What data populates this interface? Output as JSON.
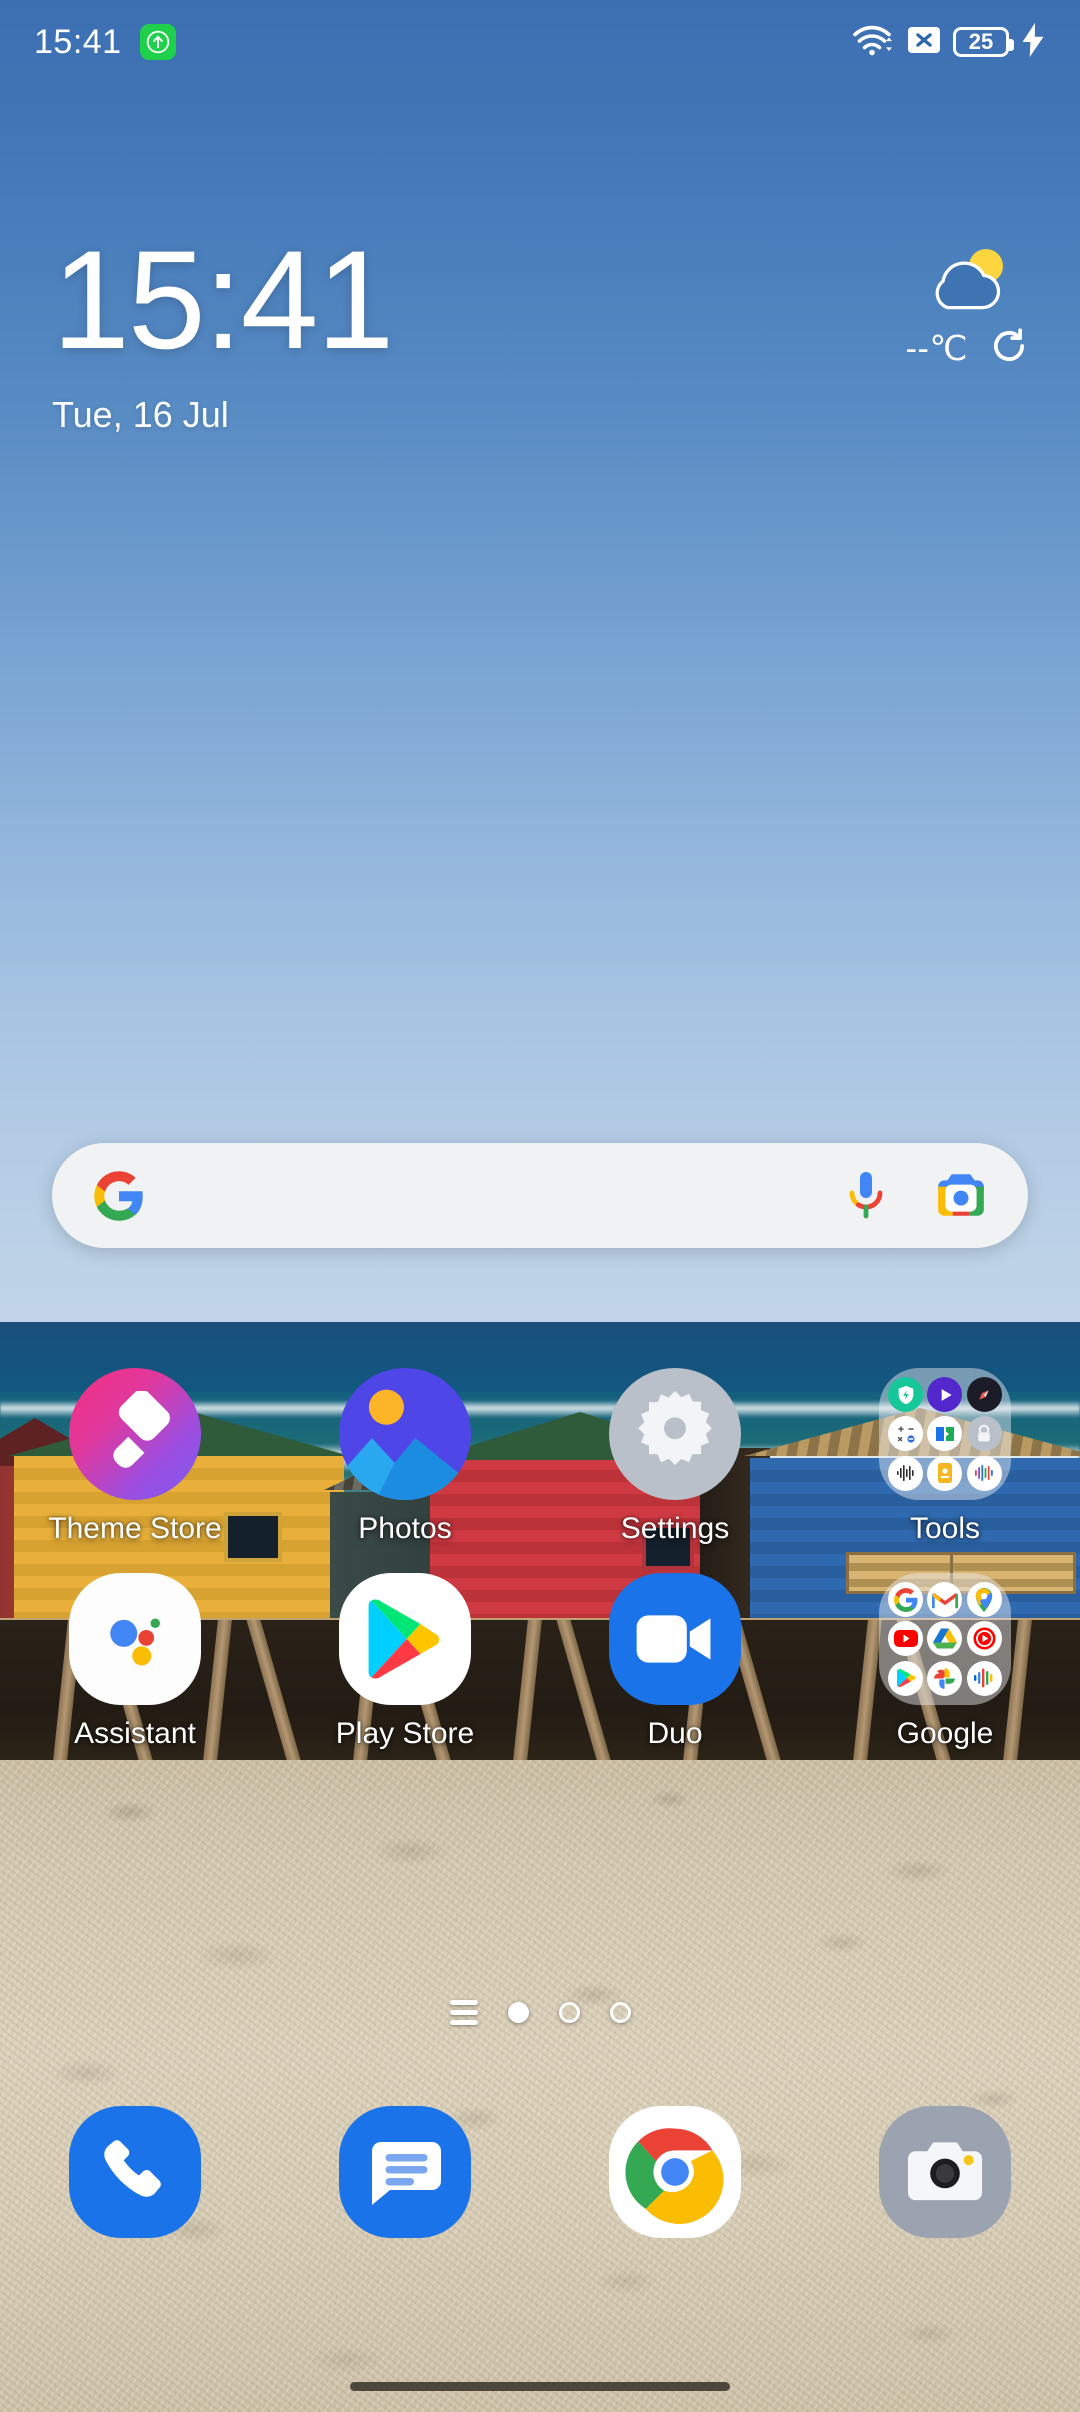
{
  "status_bar": {
    "time": "15:41",
    "vpn_badge_icon": "arrow-up-in-rounded-square-icon",
    "wifi_icon": "wifi-with-data-arrows-icon",
    "sim_icon": "no-sim-card-x-icon",
    "battery_level": "25",
    "battery_icon": "battery-outline-icon",
    "charging_icon": "lightning-bolt-icon"
  },
  "clock_widget": {
    "time": "15:41",
    "date": "Tue, 16 Jul",
    "weather_icon": "cloud-with-sun-icon",
    "temperature": "--℃",
    "refresh_icon": "refresh-circular-arrow-icon"
  },
  "search_bar": {
    "google_icon": "google-g-logo-icon",
    "mic_icon": "microphone-icon",
    "lens_icon": "google-lens-camera-icon",
    "query": "",
    "placeholder": ""
  },
  "app_grid": {
    "rows": [
      [
        {
          "label": "Theme Store",
          "icon": "theme-store-icon",
          "type": "app"
        },
        {
          "label": "Photos",
          "icon": "photos-icon",
          "type": "app"
        },
        {
          "label": "Settings",
          "icon": "settings-gear-icon",
          "type": "app"
        },
        {
          "label": "Tools",
          "icon": "folder-icon",
          "type": "folder",
          "contents": [
            "security-shield-icon",
            "video-player-icon",
            "browser-compass-icon",
            "calculator-icon",
            "file-manager-icon",
            "app-lock-icon",
            "sound-recorder-icon",
            "notes-icon",
            "recorder-icon"
          ]
        }
      ],
      [
        {
          "label": "Assistant",
          "icon": "google-assistant-icon",
          "type": "app"
        },
        {
          "label": "Play Store",
          "icon": "play-store-icon",
          "type": "app"
        },
        {
          "label": "Duo",
          "icon": "google-duo-icon",
          "type": "app"
        },
        {
          "label": "Google",
          "icon": "folder-icon",
          "type": "folder",
          "contents": [
            "google-search-icon",
            "gmail-icon",
            "google-maps-icon",
            "youtube-icon",
            "google-drive-icon",
            "youtube-music-icon",
            "google-play-movies-icon",
            "google-photos-icon",
            "google-podcasts-icon"
          ]
        }
      ]
    ]
  },
  "page_indicator": {
    "app_list_icon": "app-list-lines-icon",
    "pages": 3,
    "current_page": 1
  },
  "dock": {
    "items": [
      {
        "name": "Phone",
        "icon": "phone-handset-icon"
      },
      {
        "name": "Messages",
        "icon": "messages-bubble-icon"
      },
      {
        "name": "Chrome",
        "icon": "chrome-icon"
      },
      {
        "name": "Camera",
        "icon": "camera-icon"
      }
    ]
  },
  "nav_bar": {
    "handle_icon": "gesture-nav-handle-icon"
  },
  "colors": {
    "accent_blue": "#1a73e8",
    "google_blue": "#4285f4",
    "google_red": "#ea4335",
    "google_yellow": "#fbbc04",
    "google_green": "#34a853",
    "battery_green": "#1fd14a",
    "sky_top": "#3c6fb2",
    "sky_bottom": "#c2d5e8",
    "sand": "#d6cab2"
  }
}
